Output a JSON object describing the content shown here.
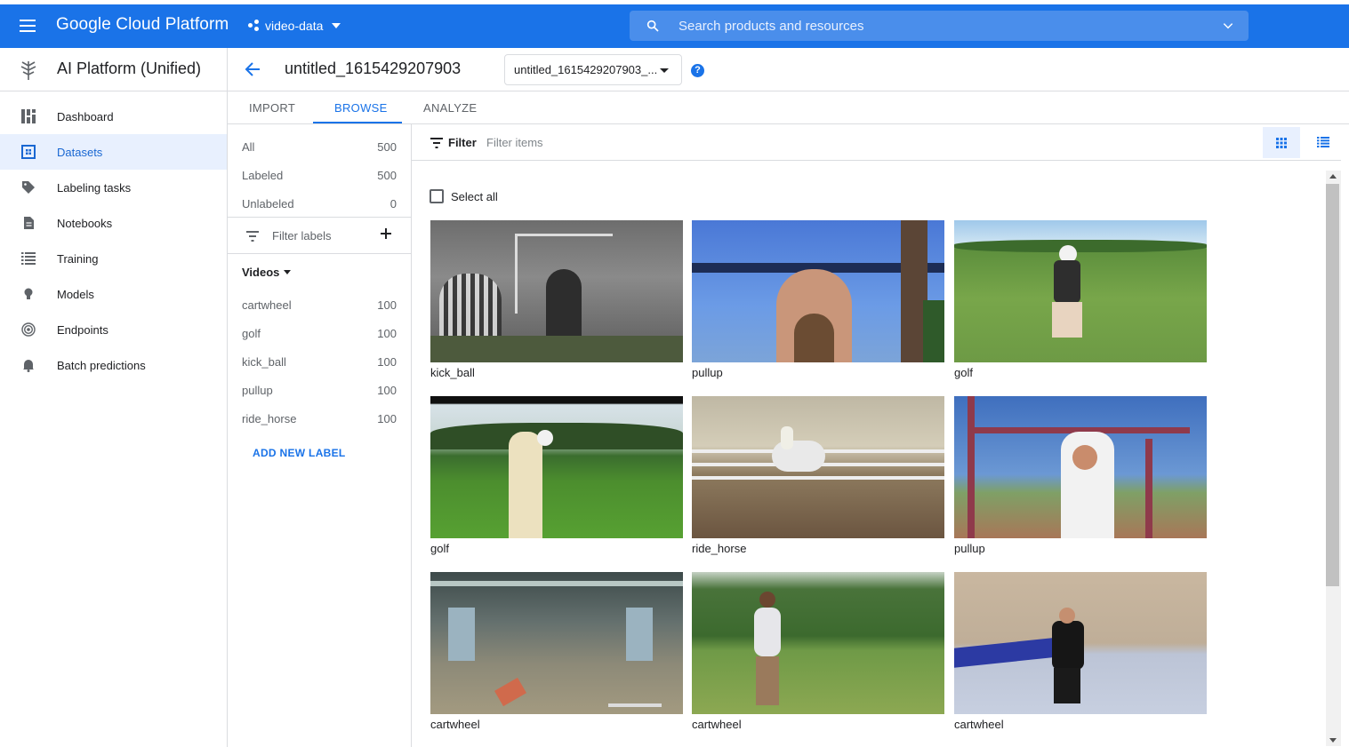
{
  "topbar": {
    "brand": "Google Cloud Platform",
    "project": "video-data",
    "search_placeholder": "Search products and resources"
  },
  "nav": {
    "title": "AI Platform (Unified)",
    "items": [
      {
        "label": "Dashboard",
        "icon": "dashboard-icon"
      },
      {
        "label": "Datasets",
        "icon": "datasets-icon"
      },
      {
        "label": "Labeling tasks",
        "icon": "tag-icon"
      },
      {
        "label": "Notebooks",
        "icon": "notebook-icon"
      },
      {
        "label": "Training",
        "icon": "list-icon"
      },
      {
        "label": "Models",
        "icon": "bulb-icon"
      },
      {
        "label": "Endpoints",
        "icon": "target-icon"
      },
      {
        "label": "Batch predictions",
        "icon": "bell-icon"
      }
    ]
  },
  "header": {
    "title": "untitled_1615429207903",
    "dataset_select": "untitled_1615429207903_..."
  },
  "tabs": {
    "import": "IMPORT",
    "browse": "BROWSE",
    "analyze": "ANALYZE"
  },
  "labels": {
    "counts": [
      {
        "label": "All",
        "count": "500"
      },
      {
        "label": "Labeled",
        "count": "500"
      },
      {
        "label": "Unlabeled",
        "count": "0"
      }
    ],
    "filter_placeholder": "Filter labels",
    "videos_heading": "Videos",
    "items": [
      {
        "label": "cartwheel",
        "count": "100"
      },
      {
        "label": "golf",
        "count": "100"
      },
      {
        "label": "kick_ball",
        "count": "100"
      },
      {
        "label": "pullup",
        "count": "100"
      },
      {
        "label": "ride_horse",
        "count": "100"
      }
    ],
    "add_new": "ADD NEW LABEL"
  },
  "content": {
    "filter_label": "Filter",
    "filter_placeholder": "Filter items",
    "select_all": "Select all",
    "tiles": [
      {
        "label": "kick_ball"
      },
      {
        "label": "pullup"
      },
      {
        "label": "golf"
      },
      {
        "label": "golf"
      },
      {
        "label": "ride_horse"
      },
      {
        "label": "pullup"
      },
      {
        "label": "cartwheel"
      },
      {
        "label": "cartwheel"
      },
      {
        "label": "cartwheel"
      }
    ]
  },
  "colors": {
    "accent": "#1a73e8",
    "active_bg": "#e8f0fe"
  }
}
